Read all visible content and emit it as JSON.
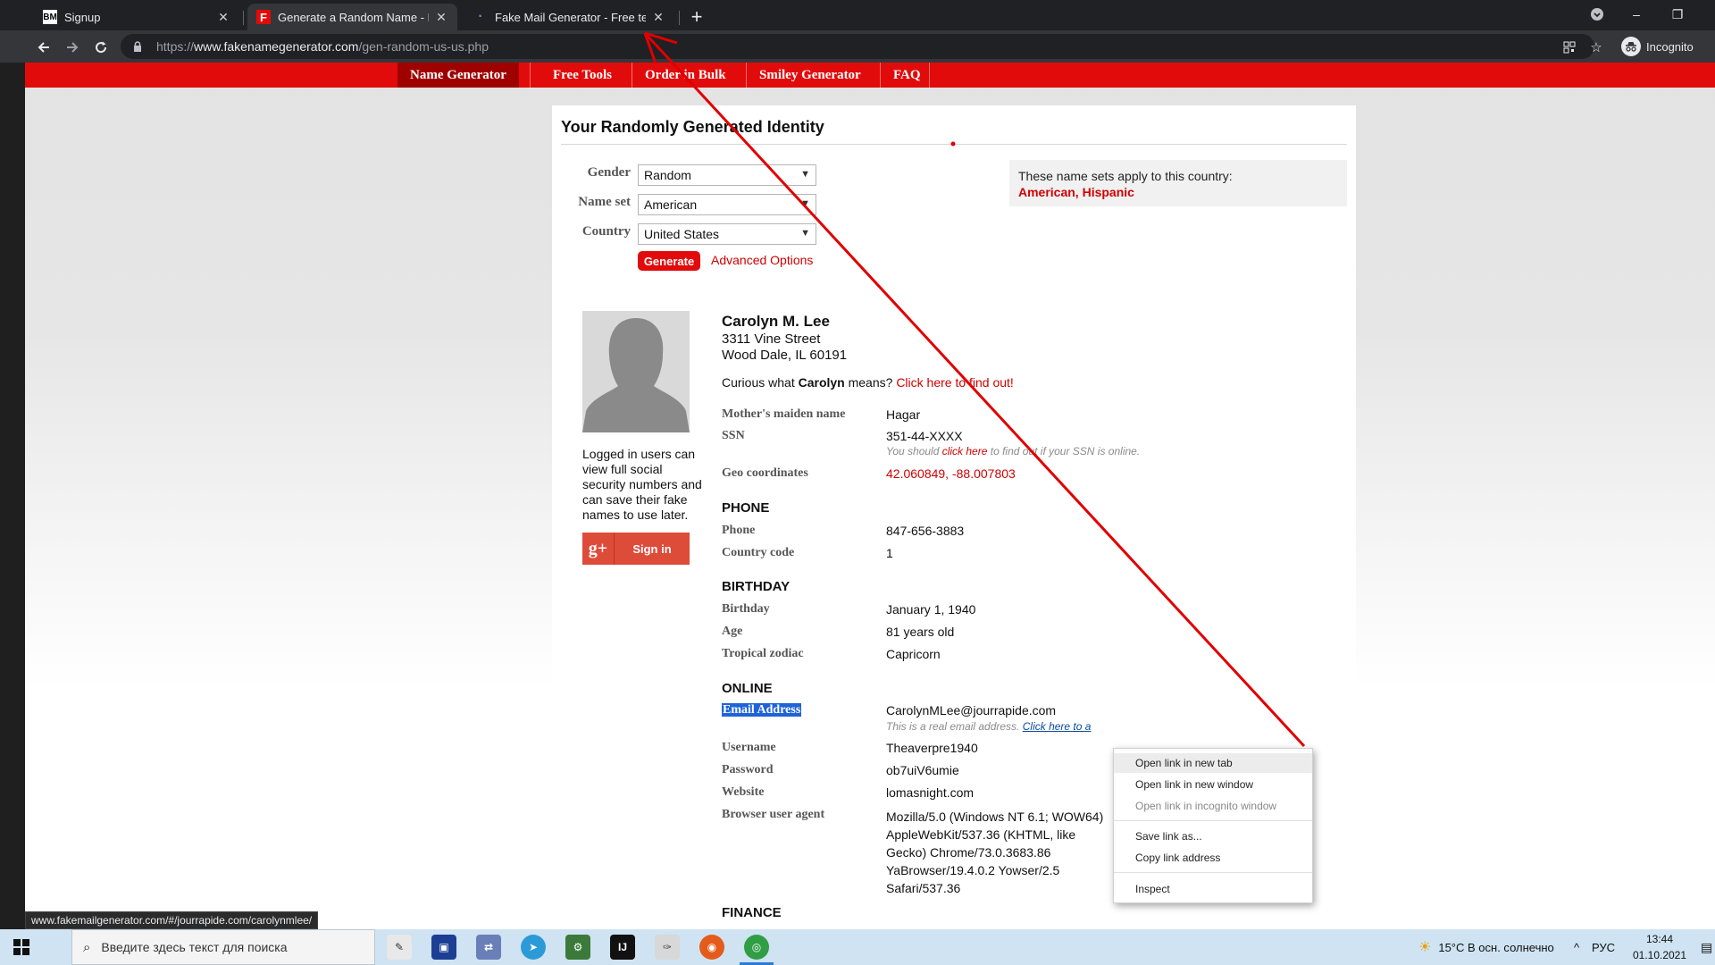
{
  "browser": {
    "tabs": [
      {
        "favicon": "BM",
        "title": "Signup",
        "active": false
      },
      {
        "favicon": "F",
        "title": "Generate a Random Name - Fake",
        "active": true
      },
      {
        "favicon": "·",
        "title": "Fake Mail Generator - Free temp",
        "active": false
      }
    ],
    "new_tab": "+",
    "window_controls": {
      "minimize": "–",
      "maximize": "❐",
      "close": "✕"
    },
    "url_scheme": "https://",
    "url_host": "www.fakenamegenerator.com",
    "url_path": "/gen-random-us-us.php",
    "profile_label": "Incognito",
    "status_url": "www.fakemailgenerator.com/#/jourrapide.com/carolynmlee/"
  },
  "site_nav": {
    "items": [
      "Name Generator",
      "Free Tools",
      "Order in Bulk",
      "Smiley Generator",
      "FAQ"
    ]
  },
  "page": {
    "heading": "Your Randomly Generated Identity",
    "form": {
      "gender_label": "Gender",
      "gender_value": "Random",
      "nameset_label": "Name set",
      "nameset_value": "American",
      "country_label": "Country",
      "country_value": "United States",
      "generate_label": "Generate",
      "advanced_label": "Advanced Options"
    },
    "nameset_box": {
      "intro": "These name sets apply to this country:",
      "sets": "American, Hispanic"
    },
    "login_note": "Logged in users can view full social security numbers and can save their fake names to use later.",
    "gplus": {
      "icon": "g+",
      "label": "Sign in"
    },
    "identity": {
      "name": "Carolyn M. Lee",
      "street": "3311 Vine Street",
      "city": "Wood Dale, IL 60191",
      "curious_prefix": "Curious what ",
      "curious_name": "Carolyn",
      "curious_mid": " means? ",
      "curious_link": "Click here to find out!"
    },
    "details": {
      "maiden_label": "Mother's maiden name",
      "maiden_value": "Hagar",
      "ssn_label": "SSN",
      "ssn_value": "351-44-XXXX",
      "ssn_note_a": "You should ",
      "ssn_note_link": "click here",
      "ssn_note_b": " to find out if your SSN is online.",
      "geo_label": "Geo coordinates",
      "geo_value": "42.060849, -88.007803"
    },
    "phone": {
      "section": "PHONE",
      "phone_label": "Phone",
      "phone_value": "847-656-3883",
      "cc_label": "Country code",
      "cc_value": "1"
    },
    "birthday": {
      "section": "BIRTHDAY",
      "birthday_label": "Birthday",
      "birthday_value": "January 1, 1940",
      "age_label": "Age",
      "age_value": "81 years old",
      "zodiac_label": "Tropical zodiac",
      "zodiac_value": "Capricorn"
    },
    "online": {
      "section": "ONLINE",
      "email_label": "Email Address",
      "email_value": "CarolynMLee@jourrapide.com",
      "email_note_a": "This is a real email address. ",
      "email_note_link": "Click here to a",
      "username_label": "Username",
      "username_value": "Theaverpre1940",
      "password_label": "Password",
      "password_value": "ob7uiV6umie",
      "website_label": "Website",
      "website_value": "lomasnight.com",
      "ua_label": "Browser user agent",
      "ua_value": "Mozilla/5.0 (Windows NT 6.1; WOW64) AppleWebKit/537.36 (KHTML, like Gecko) Chrome/73.0.3683.86 YaBrowser/19.4.0.2 Yowser/2.5 Safari/537.36"
    },
    "finance_section": "FINANCE"
  },
  "context_menu": {
    "items": [
      "Open link in new tab",
      "Open link in new window",
      "Open link in incognito window",
      "Save link as...",
      "Copy link address",
      "Inspect"
    ]
  },
  "taskbar": {
    "search_placeholder": "Введите здесь текст для поиска",
    "weather": "15°C  В осн. солнечно",
    "lang": "РУС",
    "time": "13:44",
    "date": "01.10.2021"
  },
  "colors": {
    "site_red": "#e20b0b",
    "nav_active": "#9f0000",
    "annotation_arrow": "#e00000",
    "selection": "#1e63d8"
  }
}
